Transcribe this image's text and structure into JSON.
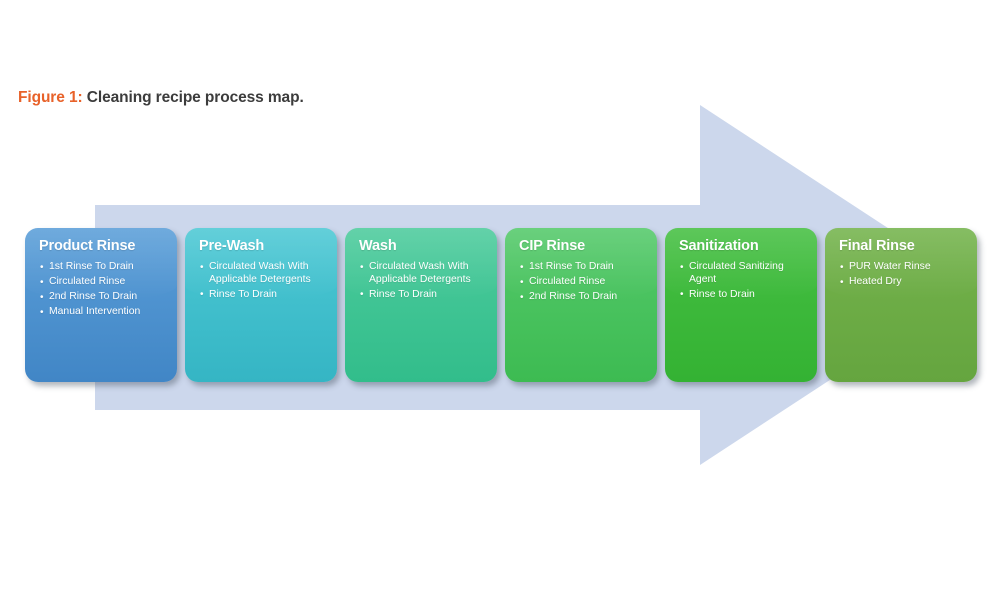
{
  "caption": {
    "label": "Figure 1:",
    "text": "Cleaning recipe process map."
  },
  "colors": {
    "caption_label": "#e8622a",
    "caption_text": "#3c3c3c",
    "arrow_fill": "#ccd7ec",
    "background": "#ffffff"
  },
  "arrow": {
    "name": "process-flow-arrow",
    "direction": "left-to-right",
    "fill": "#ccd7ec"
  },
  "stages": [
    {
      "title": "Product Rinse",
      "color_top": "#5a9ed8",
      "color_bottom": "#4186c6",
      "items": [
        "1st Rinse To Drain",
        "Circulated Rinse",
        "2nd Rinse To Drain",
        "Manual Intervention"
      ]
    },
    {
      "title": "Pre-Wash",
      "color_top": "#4cc8d4",
      "color_bottom": "#35b5c4",
      "items": [
        "Circulated Wash With Applicable Detergents",
        "Rinse To Drain"
      ]
    },
    {
      "title": "Wash",
      "color_top": "#4ccb9c",
      "color_bottom": "#32bd8b",
      "items": [
        "Circulated Wash With Applicable Detergents",
        "Rinse To Drain"
      ]
    },
    {
      "title": "CIP Rinse",
      "color_top": "#54c96a",
      "color_bottom": "#3dbb52",
      "items": [
        "1st Rinse To Drain",
        "Circulated Rinse",
        "2nd Rinse To Drain"
      ]
    },
    {
      "title": "Sanitization",
      "color_top": "#45bf42",
      "color_bottom": "#34b233",
      "items": [
        "Circulated Sanitizing Agent",
        "Rinse to Drain"
      ]
    },
    {
      "title": "Final Rinse",
      "color_top": "#74b34c",
      "color_bottom": "#65a53f",
      "items": [
        "PUR Water Rinse",
        "Heated Dry"
      ]
    }
  ]
}
